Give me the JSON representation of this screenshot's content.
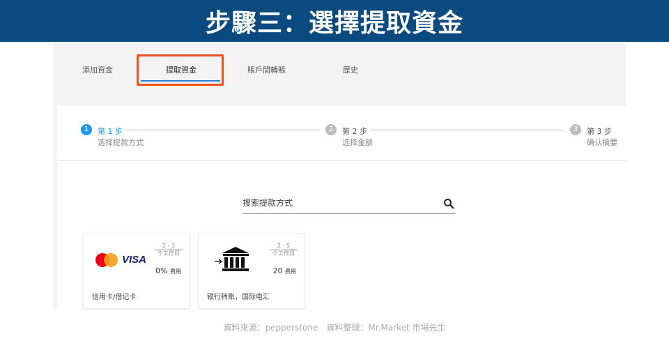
{
  "banner": {
    "title": "步驟三：選擇提取資金"
  },
  "tabs": [
    {
      "label": "添加資金"
    },
    {
      "label": "提取資金",
      "active": true
    },
    {
      "label": "賬戶間轉賬"
    },
    {
      "label": "歷史"
    }
  ],
  "stepper": {
    "steps": [
      {
        "number": "1",
        "title": "第 1 步",
        "subtitle": "选择提款方式",
        "active": true
      },
      {
        "number": "2",
        "title": "第 2 步",
        "subtitle": "选择金额"
      },
      {
        "number": "3",
        "title": "第 3 步",
        "subtitle": "确认摘要"
      }
    ]
  },
  "search": {
    "placeholder": "搜索提款方式",
    "icon": "search-icon"
  },
  "methods": [
    {
      "logo": "mastercard-visa-logo",
      "visa_text": "VISA",
      "days": "2 - 3",
      "days_unit": "个工作日",
      "fee": "0%",
      "fee_unit": "费用",
      "label": "信用卡/借记卡"
    },
    {
      "logo": "bank-icon",
      "days": "2 - 5",
      "days_unit": "个工作日",
      "fee": "20",
      "fee_unit": "费用",
      "label": "银行转账，国际电汇"
    }
  ],
  "footer": {
    "text": "資料來源：pepperstone　資料整理：Mr.Market  市場先生"
  },
  "colors": {
    "banner": "#0b4a7e",
    "active_step": "#2196f3",
    "highlight": "#e8501c",
    "mastercard_red": "#eb001b",
    "mastercard_orange": "#f79e1b",
    "visa_blue": "#1a1f71"
  }
}
